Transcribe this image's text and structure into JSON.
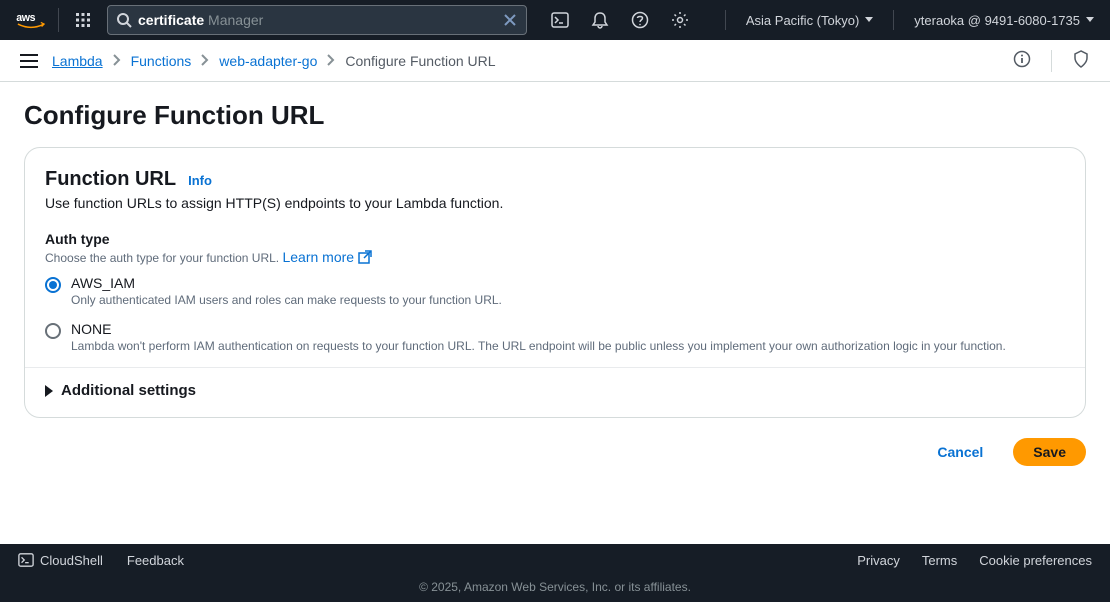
{
  "topnav": {
    "search_typed": "certificate",
    "search_suggestion": " Manager",
    "region": "Asia Pacific (Tokyo)",
    "user": "yteraoka @ 9491-6080-1735"
  },
  "breadcrumb": {
    "items": [
      "Lambda",
      "Functions",
      "web-adapter-go",
      "Configure Function URL"
    ]
  },
  "page": {
    "title": "Configure Function URL"
  },
  "card": {
    "title": "Function URL",
    "info": "Info",
    "desc": "Use function URLs to assign HTTP(S) endpoints to your Lambda function.",
    "auth_label": "Auth type",
    "auth_help": "Choose the auth type for your function URL.",
    "learn_more": "Learn more",
    "options": [
      {
        "value": "AWS_IAM",
        "desc": "Only authenticated IAM users and roles can make requests to your function URL.",
        "selected": true
      },
      {
        "value": "NONE",
        "desc": "Lambda won't perform IAM authentication on requests to your function URL. The URL endpoint will be public unless you implement your own authorization logic in your function.",
        "selected": false
      }
    ],
    "additional": "Additional settings"
  },
  "actions": {
    "cancel": "Cancel",
    "save": "Save"
  },
  "footer": {
    "cloudshell": "CloudShell",
    "feedback": "Feedback",
    "privacy": "Privacy",
    "terms": "Terms",
    "cookies": "Cookie preferences",
    "copyright": "© 2025, Amazon Web Services, Inc. or its affiliates."
  }
}
